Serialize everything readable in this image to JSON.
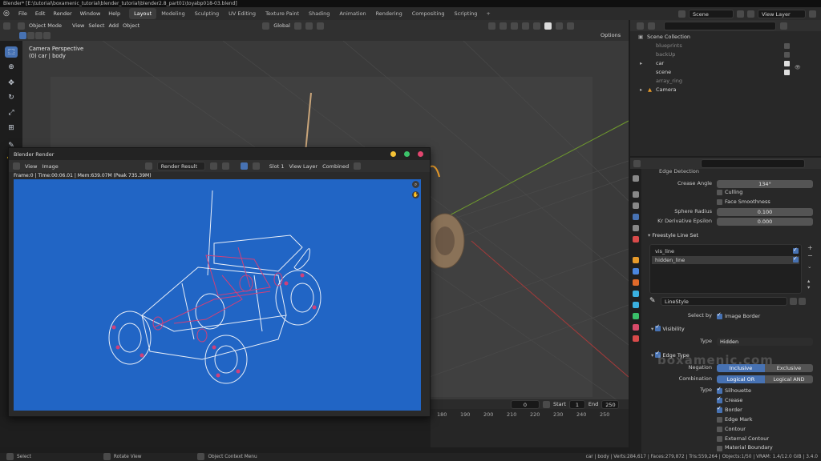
{
  "window_title": "Blender* [E:\\tutorial\\boxamenic_tutorial\\blender_tutorial\\blender2.8_part01\\toyabp018-03.blend]",
  "menus": [
    "File",
    "Edit",
    "Render",
    "Window",
    "Help"
  ],
  "workspaces": [
    "Layout",
    "Modeling",
    "Sculpting",
    "UV Editing",
    "Texture Paint",
    "Shading",
    "Animation",
    "Rendering",
    "Compositing",
    "Scripting"
  ],
  "active_workspace": "Layout",
  "scene_name": "Scene",
  "view_layer": "View Layer",
  "viewport": {
    "mode": "Object Mode",
    "menu": [
      "View",
      "Select",
      "Add",
      "Object"
    ],
    "orientation": "Global",
    "options": "Options",
    "overlay_title": "Camera Perspective",
    "overlay_sub": "(0) car | body"
  },
  "render_window": {
    "title": "Blender Render",
    "menu": [
      "View",
      "Image"
    ],
    "image_name": "Render Result",
    "slot": "Slot 1",
    "layer": "View Layer",
    "pass": "Combined",
    "info": "Frame:0 | Time:00:06.01 | Mem:639.07M (Peak 735.39M)"
  },
  "timeline": {
    "current_frame": "0",
    "start_label": "Start",
    "start": "1",
    "end_label": "End",
    "end": "250",
    "ruler": [
      "180",
      "190",
      "200",
      "210",
      "220",
      "230",
      "240",
      "250"
    ]
  },
  "outliner": {
    "items": [
      {
        "name": "Scene Collection",
        "level": 0
      },
      {
        "name": "blueprints",
        "level": 1,
        "dim": true
      },
      {
        "name": "backUp",
        "level": 1,
        "dim": true
      },
      {
        "name": "car",
        "level": 1
      },
      {
        "name": "scene",
        "level": 1
      },
      {
        "name": "array_ring",
        "level": 1,
        "dim": true
      },
      {
        "name": "Camera",
        "level": 1
      }
    ]
  },
  "properties": {
    "section_edge_detection": "Edge Detection",
    "crease_angle_label": "Crease Angle",
    "crease_angle": "134°",
    "culling": "Culling",
    "face_smoothness": "Face Smoothness",
    "sphere_radius_label": "Sphere Radius",
    "sphere_radius": "0.100",
    "kr_label": "Kr Derivative Epsilon",
    "kr": "0.000",
    "lineset_title": "Freestyle Line Set",
    "linesets": [
      "vis_line",
      "hidden_line"
    ],
    "linestyle": "LineStyle",
    "select_by_label": "Select by",
    "image_border": "Image Border",
    "visibility": "Visibility",
    "type_label": "Type",
    "visibility_type": "Hidden",
    "edge_type": "Edge Type",
    "negation_label": "Negation",
    "inclusive": "Inclusive",
    "exclusive": "Exclusive",
    "combination_label": "Combination",
    "logical_or": "Logical OR",
    "logical_and": "Logical AND",
    "edge_types": [
      {
        "name": "Silhouette",
        "checked": true
      },
      {
        "name": "Crease",
        "checked": true
      },
      {
        "name": "Border",
        "checked": true
      },
      {
        "name": "Edge Mark",
        "checked": false
      },
      {
        "name": "Contour",
        "checked": false
      },
      {
        "name": "External Contour",
        "checked": false
      },
      {
        "name": "Material Boundary",
        "checked": false
      }
    ]
  },
  "status": {
    "select": "Select",
    "rotate": "Rotate View",
    "context": "Object Context Menu",
    "stats": "car | body | Verts:284,617 | Faces:279,872 | Tris:559,264 | Objects:1/50 | VRAM: 1.4/12.0 GiB | 3.4.0"
  },
  "watermark": "boxamenic.com",
  "colors": {
    "accent": "#4772b3",
    "render_bg": "#2165c5",
    "wire_white": "#e8eef8",
    "wire_pink": "#d0407a"
  }
}
